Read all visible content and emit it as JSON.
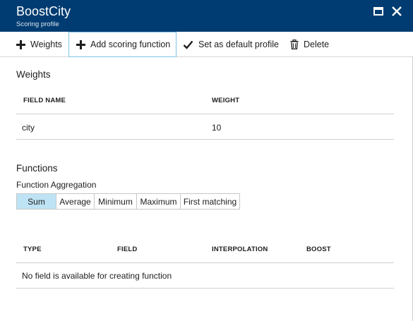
{
  "header": {
    "title": "BoostCity",
    "subtitle": "Scoring profile",
    "maximize_icon": "maximize-icon",
    "close_icon": "close-icon",
    "background": "#003c71"
  },
  "toolbar": {
    "weights_label": "Weights",
    "add_function_label": "Add scoring function",
    "set_default_label": "Set as default profile",
    "delete_label": "Delete"
  },
  "weights": {
    "title": "Weights",
    "columns": [
      "FIELD NAME",
      "WEIGHT"
    ],
    "rows": [
      {
        "field": "city",
        "weight": "10"
      }
    ]
  },
  "functions": {
    "title": "Functions",
    "aggregation_label": "Function Aggregation",
    "aggregation_options": [
      "Sum",
      "Average",
      "Minimum",
      "Maximum",
      "First matching"
    ],
    "aggregation_selected": "Sum",
    "columns": [
      "TYPE",
      "FIELD",
      "INTERPOLATION",
      "BOOST"
    ],
    "empty_message": "No field is available for creating function"
  },
  "colors": {
    "accent": "#003c71",
    "selected_segment": "#bee3f5",
    "focus_border": "#7fc4e8"
  }
}
